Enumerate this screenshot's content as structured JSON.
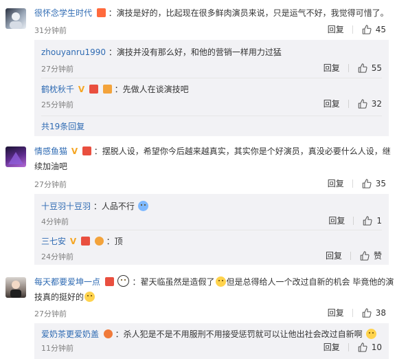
{
  "comments": [
    {
      "user": "很怀念学生时代",
      "text": "：演技是好的，比起现在很多鲜肉演员来说，只是运气不好，我觉得可惜了。",
      "time": "31分钟前",
      "reply_label": "回复",
      "likes": "45",
      "replies": [
        {
          "user": "zhouyanru1990",
          "text": "：演技并没有那么好，和他的营销一样用力过猛",
          "time": "27分钟前",
          "reply_label": "回复",
          "likes": "55"
        },
        {
          "user": "鹤枕秋千",
          "text": "：先做人在谈演技吧",
          "time": "25分钟前",
          "reply_label": "回复",
          "likes": "32"
        }
      ],
      "more_label": "共19条回复"
    },
    {
      "user": "情感鱼猫",
      "text_line1": "：摆脱人设，希望你今后越来越真实，其实你是个好演员，真没必要什么人设，继",
      "text_line2": "续加油吧",
      "time": "27分钟前",
      "reply_label": "回复",
      "likes": "35",
      "replies": [
        {
          "user": "十豆羽十豆羽",
          "text": "：人品不行",
          "time": "4分钟前",
          "reply_label": "回复",
          "likes": "1"
        },
        {
          "user": "三七安",
          "text": "：顶",
          "time": "24分钟前",
          "reply_label": "回复",
          "likes": "赞"
        }
      ]
    },
    {
      "user": "每天都要爱坤一点",
      "text_line1a": "：翟天临虽然是造假了",
      "text_line1b": "但是总得给人一个改过自新的机会 毕竟他的演",
      "text_line2": "技真的挺好的",
      "time": "27分钟前",
      "reply_label": "回复",
      "likes": "38",
      "replies": [
        {
          "user": "爱奶茶更爱奶盖",
          "text": "：杀人犯是不是不用服刑不用接受惩罚就可以让他出社会改过自新啊",
          "time": "11分钟前",
          "reply_label": "回复",
          "likes": "10"
        }
      ]
    }
  ],
  "colors": {
    "username_orange": "#eb7350",
    "username_blue": "#2f6bb3",
    "reply_bg": "#f2f2f5",
    "meta_gray": "#808080"
  },
  "icons": {
    "like": "thumb-up-icon",
    "vip": "v-badge-icon",
    "emoji": "smiley-emoji-icon"
  }
}
